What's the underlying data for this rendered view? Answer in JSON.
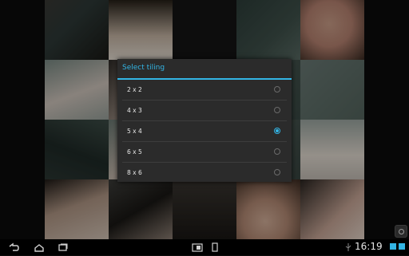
{
  "dialog": {
    "title": "Select tiling",
    "options": [
      {
        "label": "2 x 2",
        "selected": false
      },
      {
        "label": "4 x 3",
        "selected": false
      },
      {
        "label": "5 x 4",
        "selected": true
      },
      {
        "label": "6 x 5",
        "selected": false
      },
      {
        "label": "8 x 6",
        "selected": false
      }
    ]
  },
  "statusbar": {
    "clock": "16:19"
  },
  "colors": {
    "accent": "#33b5e5",
    "dialog_bg": "#2b2b2b"
  },
  "icons": {
    "back": "back-icon",
    "home": "home-icon",
    "recents": "recents-icon",
    "screenshot": "screenshot-icon",
    "menu": "menu-icon"
  }
}
